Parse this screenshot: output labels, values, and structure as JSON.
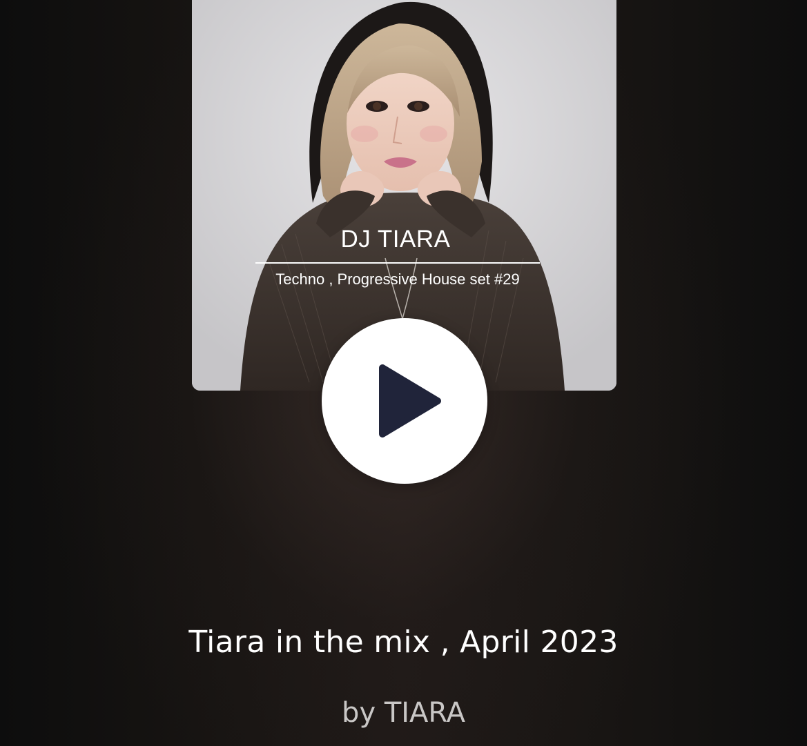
{
  "cover": {
    "title": "DJ TIARA",
    "subtitle": "Techno , Progressive House set #29"
  },
  "player": {
    "play_icon": "play-icon",
    "button_color": "#ffffff",
    "icon_color": "#20243a"
  },
  "track": {
    "title": "Tiara in the mix , April 2023",
    "artist": "by TIARA"
  }
}
